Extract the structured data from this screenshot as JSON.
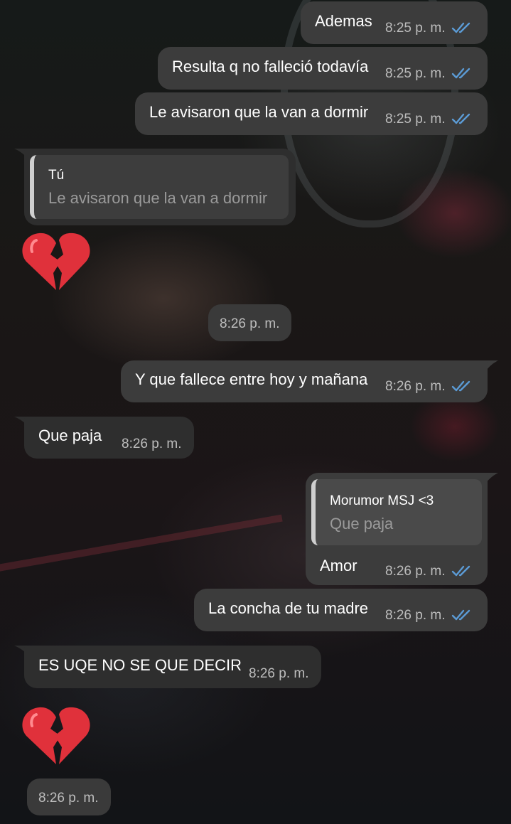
{
  "messages": [
    {
      "id": "m1",
      "direction": "out",
      "text": "Ademas",
      "time": "8:25 p. m.",
      "status": "read"
    },
    {
      "id": "m2",
      "direction": "out",
      "text": "Resulta q no falleció todavía",
      "time": "8:25 p. m.",
      "status": "read"
    },
    {
      "id": "m3",
      "direction": "out",
      "text": "Le avisaron que la van a dormir",
      "time": "8:25 p. m.",
      "status": "read"
    },
    {
      "id": "m4",
      "direction": "in",
      "reply_name": "Tú",
      "reply_text": "Le avisaron que la van a dormir",
      "emoji": "broken-heart"
    },
    {
      "id": "m4t",
      "direction": "in",
      "time": "8:26 p. m."
    },
    {
      "id": "m5",
      "direction": "out",
      "text": "Y que fallece entre hoy y mañana",
      "time": "8:26 p. m.",
      "status": "read"
    },
    {
      "id": "m6",
      "direction": "in",
      "text": "Que paja",
      "time": "8:26 p. m."
    },
    {
      "id": "m7",
      "direction": "out",
      "reply_name": "Morumor MSJ <3",
      "reply_text": "Que paja",
      "text": "Amor",
      "time": "8:26 p. m.",
      "status": "read"
    },
    {
      "id": "m8",
      "direction": "out",
      "text": "La concha de tu madre",
      "time": "8:26 p. m.",
      "status": "read"
    },
    {
      "id": "m9",
      "direction": "in",
      "text": "ES UQE NO SE QUE DECIR",
      "time": "8:26 p. m."
    },
    {
      "id": "m10",
      "direction": "in",
      "emoji": "broken-heart",
      "time": "8:26 p. m."
    }
  ],
  "colors": {
    "outgoing_bubble": "#3c3c3c",
    "incoming_bubble": "#2e2e2e",
    "read_checks": "#5b9bd5",
    "time_text": "#bdbdbd",
    "broken_heart": "#e0313b"
  }
}
